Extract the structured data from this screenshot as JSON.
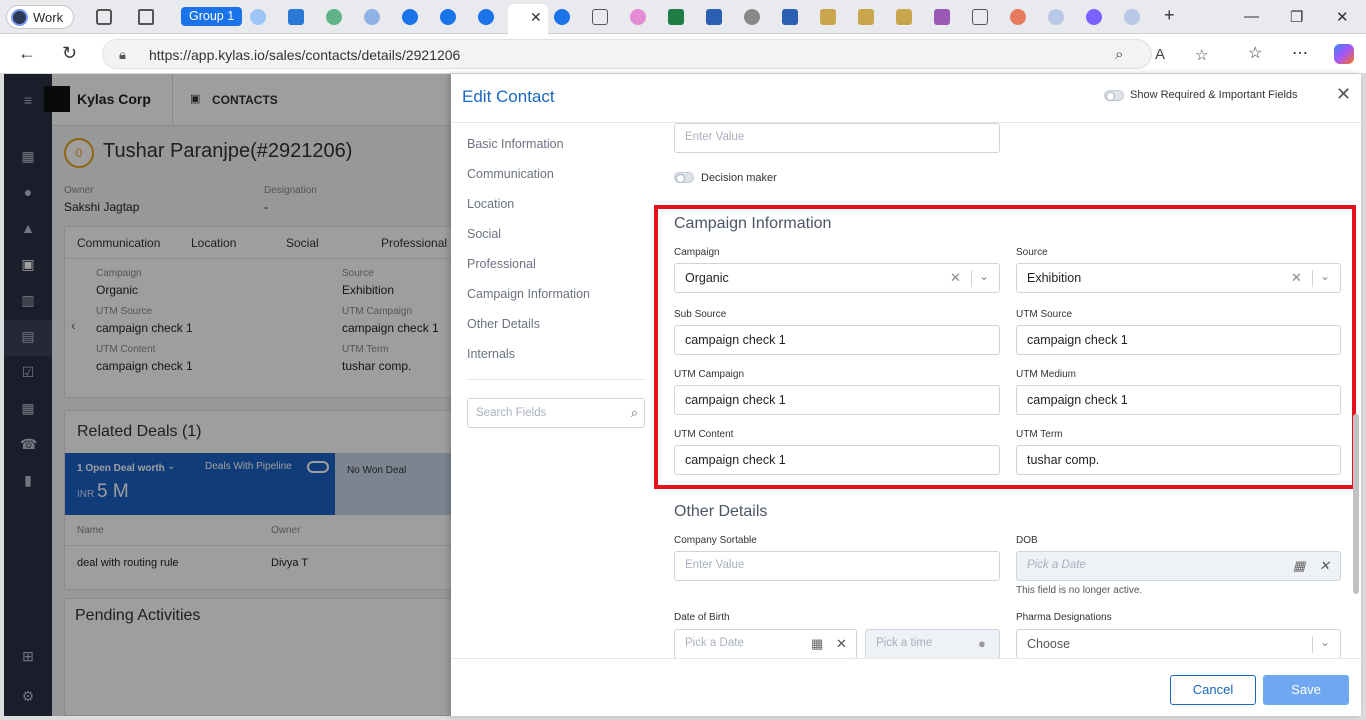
{
  "browser": {
    "profile_label": "Work",
    "group_label": "Group 1",
    "url": "https://app.kylas.io/sales/contacts/details/2921206"
  },
  "app": {
    "company_name": "Kylas Corp",
    "module_label": "CONTACTS"
  },
  "contact": {
    "name": "Tushar Paranjpe(#2921206)",
    "score": "0",
    "owner_label": "Owner",
    "owner_value": "Sakshi Jagtap",
    "designation_label": "Designation",
    "designation_value": "-",
    "tabs": [
      "Communication",
      "Location",
      "Social",
      "Professional"
    ],
    "fields": [
      {
        "label": "Campaign",
        "value": "Organic"
      },
      {
        "label": "Source",
        "value": "Exhibition"
      },
      {
        "label": "UTM Source",
        "value": "campaign check 1"
      },
      {
        "label": "UTM Campaign",
        "value": "campaign check 1"
      },
      {
        "label": "UTM Content",
        "value": "campaign check 1"
      },
      {
        "label": "UTM Term",
        "value": "tushar comp."
      }
    ]
  },
  "deals": {
    "title": "Related Deals (1)",
    "open_worth": "1 Open Deal worth",
    "currency": "INR",
    "amount": "5 M",
    "pipeline_label": "Deals With Pipeline",
    "won_label": "No Won Deal",
    "col_name": "Name",
    "col_owner": "Owner",
    "row_name": "deal with routing rule",
    "row_owner": "Divya T"
  },
  "activities": {
    "title": "Pending Activities"
  },
  "drawer": {
    "title": "Edit Contact",
    "toggle_label": "Show Required & Important Fields",
    "sections": [
      "Basic Information",
      "Communication",
      "Location",
      "Social",
      "Professional",
      "Campaign Information",
      "Other Details",
      "Internals"
    ],
    "search_placeholder": "Search Fields",
    "top_input_placeholder": "Enter Value",
    "decision_maker_label": "Decision maker",
    "campaign_section_title": "Campaign Information",
    "campaign_label": "Campaign",
    "campaign_value": "Organic",
    "source_label": "Source",
    "source_value": "Exhibition",
    "sub_source_label": "Sub Source",
    "sub_source_value": "campaign check 1",
    "utm_source_label": "UTM Source",
    "utm_source_value": "campaign check 1",
    "utm_campaign_label": "UTM Campaign",
    "utm_campaign_value": "campaign check 1",
    "utm_medium_label": "UTM Medium",
    "utm_medium_value": "campaign check 1",
    "utm_content_label": "UTM Content",
    "utm_content_value": "campaign check 1",
    "utm_term_label": "UTM Term",
    "utm_term_value": "tushar comp.",
    "other_section_title": "Other Details",
    "company_sortable_label": "Company Sortable",
    "company_sortable_placeholder": "Enter Value",
    "dob_label": "DOB",
    "dob_placeholder": "Pick a Date",
    "dob_hint": "This field is no longer active.",
    "date_of_birth_label": "Date of Birth",
    "date_placeholder": "Pick a Date",
    "time_placeholder": "Pick a time",
    "pharma_label": "Pharma Designations",
    "pharma_placeholder": "Choose",
    "cancel_label": "Cancel",
    "save_label": "Save"
  }
}
